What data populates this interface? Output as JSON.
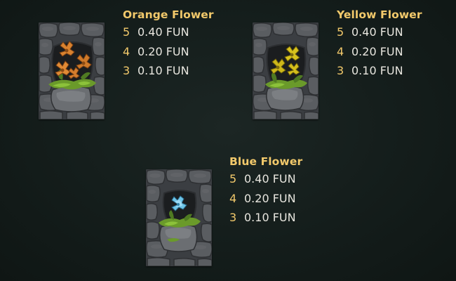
{
  "colors": {
    "background": "#151e1c",
    "title": "#f2c96b",
    "count": "#f2c96b",
    "payout": "#e8e6df",
    "stone": "#55585c",
    "moss": "#6c9a2c"
  },
  "symbols": [
    {
      "name": "Orange Flower",
      "icon": "orange-flower-icon",
      "flower_color": "#d9822f",
      "paytable": [
        {
          "count": "5",
          "payout": "0.40 FUN"
        },
        {
          "count": "4",
          "payout": "0.20 FUN"
        },
        {
          "count": "3",
          "payout": "0.10 FUN"
        }
      ]
    },
    {
      "name": "Yellow Flower",
      "icon": "yellow-flower-icon",
      "flower_color": "#d8c21e",
      "paytable": [
        {
          "count": "5",
          "payout": "0.40 FUN"
        },
        {
          "count": "4",
          "payout": "0.20 FUN"
        },
        {
          "count": "3",
          "payout": "0.10 FUN"
        }
      ]
    },
    {
      "name": "Blue Flower",
      "icon": "blue-flower-icon",
      "flower_color": "#6ec4e8",
      "paytable": [
        {
          "count": "5",
          "payout": "0.40 FUN"
        },
        {
          "count": "4",
          "payout": "0.20 FUN"
        },
        {
          "count": "3",
          "payout": "0.10 FUN"
        }
      ]
    }
  ]
}
